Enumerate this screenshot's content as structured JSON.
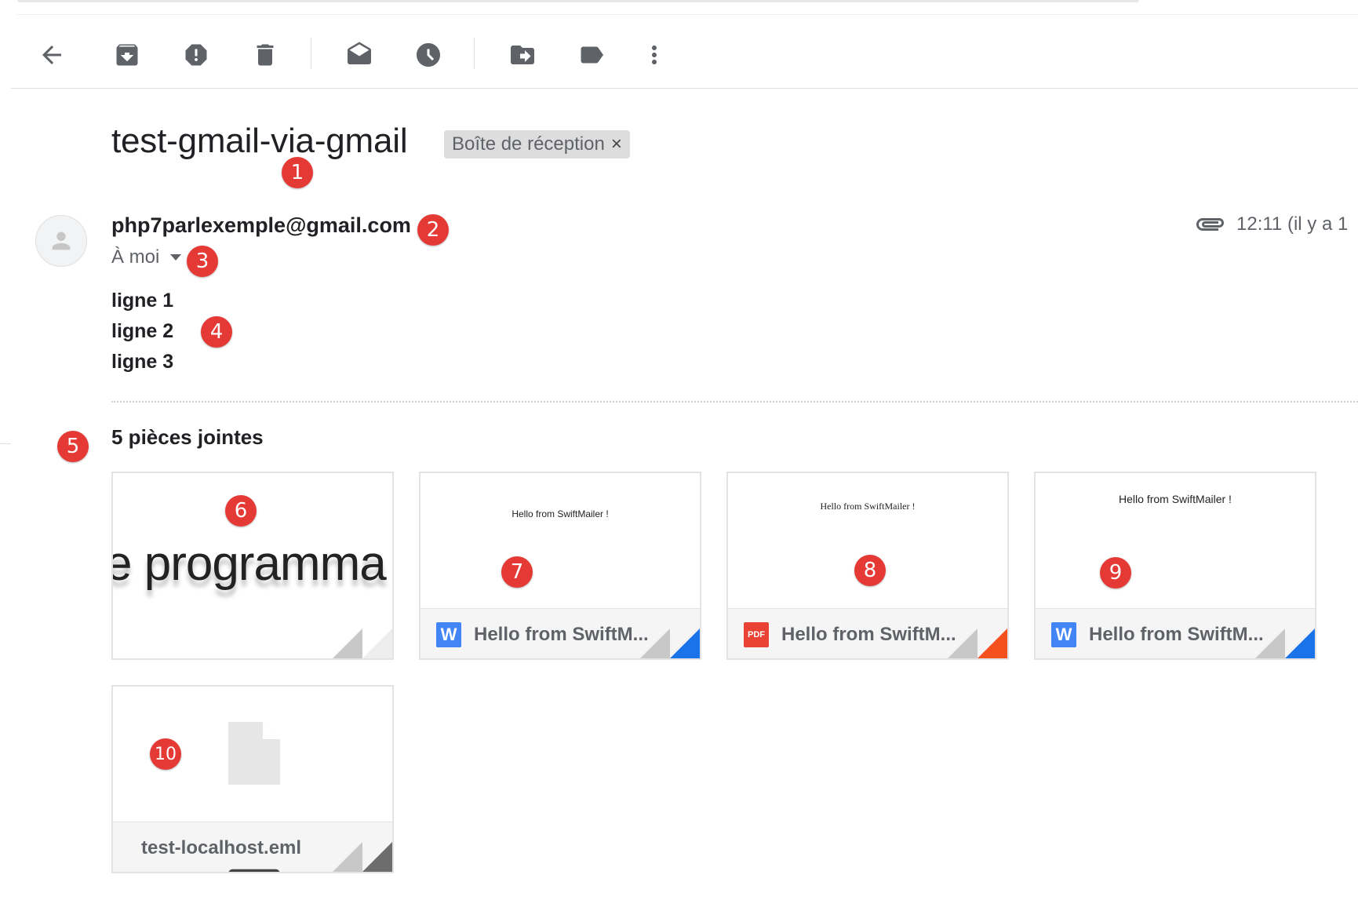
{
  "toolbar": {
    "back": "arrow-left-icon",
    "archive": "archive-icon",
    "spam": "report-spam-icon",
    "delete": "delete-icon",
    "mark_unread": "mark-unread-icon",
    "snooze": "snooze-icon",
    "move": "move-to-icon",
    "label": "label-icon",
    "more": "more-vert-icon"
  },
  "email": {
    "subject": "test-gmail-via-gmail",
    "label_chip": "Boîte de réception",
    "label_close": "×",
    "sender": "php7parlexemple@gmail.com",
    "recipient": "À moi",
    "time": "12:11 (il y a 1",
    "body_lines": [
      "ligne 1",
      "ligne 2",
      "ligne 3"
    ]
  },
  "attachments": {
    "count_label": "5 pièces jointes",
    "items": [
      {
        "preview_text": "e programma",
        "name": "",
        "type": "image"
      },
      {
        "preview_text": "Hello from SwiftMailer !",
        "name": "Hello from SwiftM...",
        "type": "word",
        "icon_label": "W",
        "accent": "#1a73e8"
      },
      {
        "preview_text": "Hello from SwiftMailer !",
        "name": "Hello from SwiftM...",
        "type": "pdf",
        "icon_label": "PDF",
        "accent": "#f4511e"
      },
      {
        "preview_text": "Hello from SwiftMailer !",
        "name": "Hello from SwiftM...",
        "type": "word",
        "icon_label": "W",
        "accent": "#1a73e8"
      },
      {
        "preview_text": "",
        "name": "test-localhost.eml",
        "type": "eml",
        "accent": "#6d6d6d"
      }
    ]
  },
  "markers": [
    "1",
    "2",
    "3",
    "4",
    "5",
    "6",
    "7",
    "8",
    "9",
    "10"
  ]
}
